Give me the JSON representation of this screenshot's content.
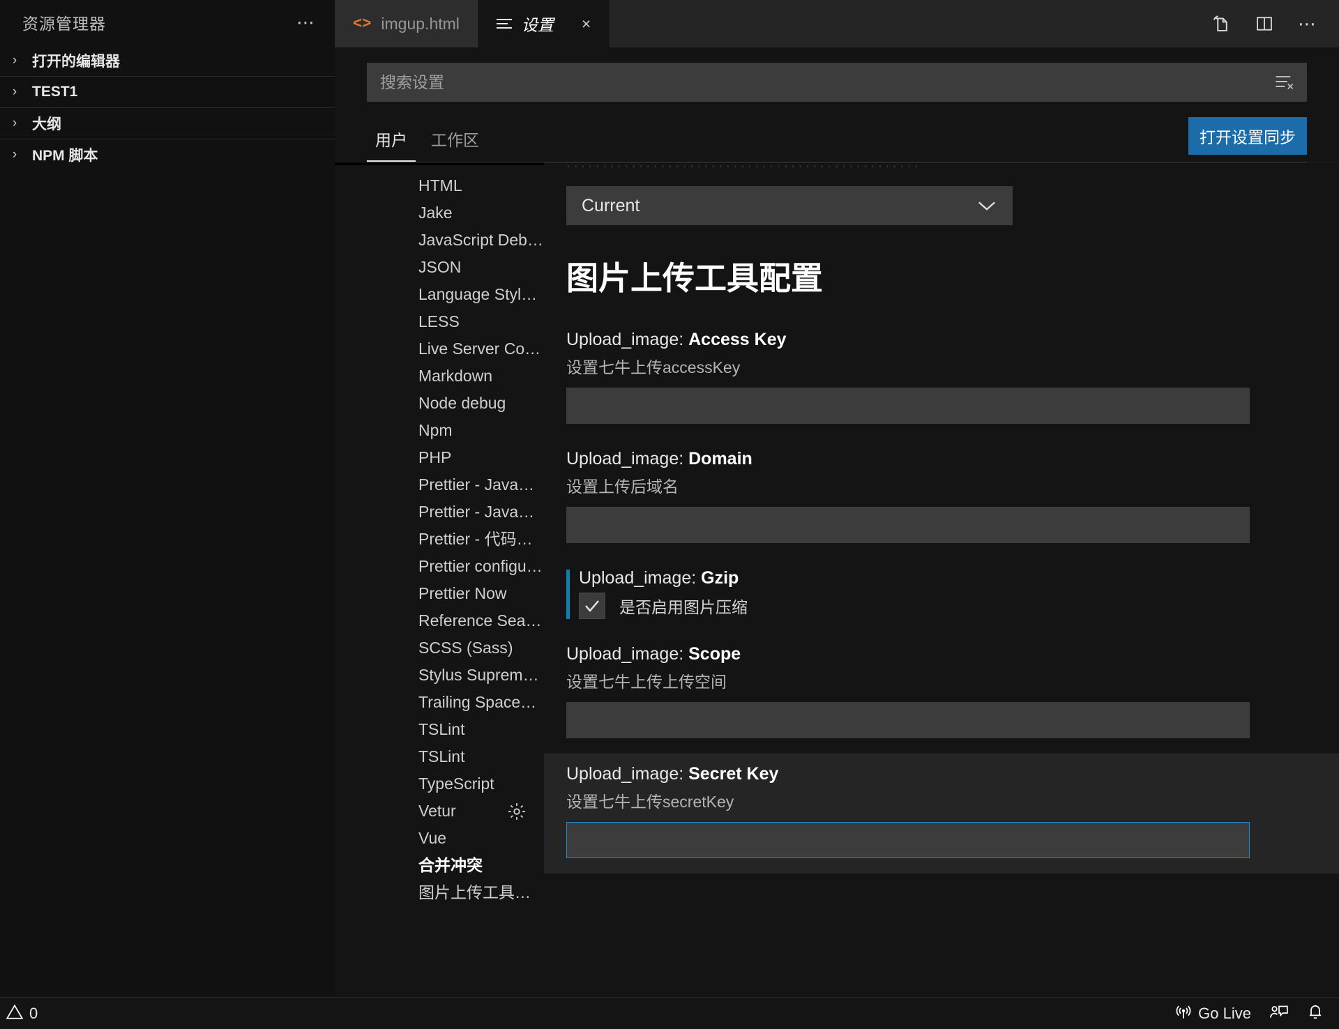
{
  "sidebar": {
    "title": "资源管理器",
    "more_icon": "ellipsis-icon",
    "items": [
      {
        "label": "打开的编辑器"
      },
      {
        "label": "TEST1"
      },
      {
        "label": "大纲"
      },
      {
        "label": "NPM 脚本"
      }
    ]
  },
  "tabs": [
    {
      "label": "imgup.html",
      "icon": "html-file-icon",
      "active": false
    },
    {
      "label": "设置",
      "icon": "settings-lines-icon",
      "active": true,
      "close": "×"
    }
  ],
  "tabbar_actions": [
    {
      "name": "open-settings-json-icon"
    },
    {
      "name": "split-editor-icon"
    },
    {
      "name": "more-actions-icon"
    }
  ],
  "search": {
    "placeholder": "搜索设置",
    "value": "",
    "clear_filters_icon": "clear-filters-icon"
  },
  "settings_tabs": [
    {
      "label": "用户",
      "active": true
    },
    {
      "label": "工作区",
      "active": false
    }
  ],
  "sync_button": {
    "label": "打开设置同步"
  },
  "toc": {
    "items": [
      {
        "label": "HTML",
        "bold": false
      },
      {
        "label": "Jake",
        "bold": false
      },
      {
        "label": "JavaScript Debug...",
        "bold": false
      },
      {
        "label": "JSON",
        "bold": false
      },
      {
        "label": "Language Stylus ...",
        "bold": false
      },
      {
        "label": "LESS",
        "bold": false
      },
      {
        "label": "Live Server Config",
        "bold": false
      },
      {
        "label": "Markdown",
        "bold": false
      },
      {
        "label": "Node debug",
        "bold": false
      },
      {
        "label": "Npm",
        "bold": false
      },
      {
        "label": "PHP",
        "bold": false
      },
      {
        "label": "Prettier - JavaScri...",
        "bold": false
      },
      {
        "label": "Prettier - JavaScri...",
        "bold": false
      },
      {
        "label": "Prettier - 代码格式...",
        "bold": false
      },
      {
        "label": "Prettier configurat...",
        "bold": false
      },
      {
        "label": "Prettier Now",
        "bold": false
      },
      {
        "label": "Reference Search ...",
        "bold": false
      },
      {
        "label": "SCSS (Sass)",
        "bold": false
      },
      {
        "label": "Stylus Supremacy",
        "bold": false
      },
      {
        "label": "Trailing Spaces C...",
        "bold": false
      },
      {
        "label": "TSLint",
        "bold": false
      },
      {
        "label": "TSLint",
        "bold": false
      },
      {
        "label": "TypeScript",
        "bold": false
      },
      {
        "label": "Vetur",
        "bold": false,
        "gear": true
      },
      {
        "label": "Vue",
        "bold": false
      },
      {
        "label": "合并冲突",
        "bold": true
      },
      {
        "label": "图片上传工具配置",
        "bold": false
      }
    ]
  },
  "settings_body": {
    "dropdown": {
      "value": "Current",
      "chevron": "chevron-down-icon"
    },
    "page_title": "图片上传工具配置",
    "rows": [
      {
        "prefix": "Upload_image: ",
        "key": "Access Key",
        "desc": "设置七牛上传accessKey",
        "control": "text",
        "value": "",
        "modified": false,
        "focused": false,
        "hovered": false
      },
      {
        "prefix": "Upload_image: ",
        "key": "Domain",
        "desc": "设置上传后域名",
        "control": "text",
        "value": "",
        "modified": false,
        "focused": false,
        "hovered": false
      },
      {
        "prefix": "Upload_image: ",
        "key": "Gzip",
        "desc": "",
        "control": "checkbox",
        "checkbox_label": "是否启用图片压缩",
        "checked": true,
        "modified": true,
        "focused": false,
        "hovered": false
      },
      {
        "prefix": "Upload_image: ",
        "key": "Scope",
        "desc": "设置七牛上传上传空间",
        "control": "text",
        "value": "",
        "modified": false,
        "focused": false,
        "hovered": false
      },
      {
        "prefix": "Upload_image: ",
        "key": "Secret Key",
        "desc": "设置七牛上传secretKey",
        "control": "text",
        "value": "",
        "modified": false,
        "focused": true,
        "hovered": true
      }
    ]
  },
  "statusbar": {
    "left": [
      {
        "name": "problems",
        "icon": "warning-triangle-icon",
        "label": "0"
      }
    ],
    "right": [
      {
        "name": "go-live",
        "icon": "broadcast-icon",
        "label": "Go Live"
      },
      {
        "name": "feedback",
        "icon": "feedback-icon",
        "label": ""
      },
      {
        "name": "notifications",
        "icon": "bell-icon",
        "label": ""
      }
    ]
  },
  "colors": {
    "accent_blue": "#1b6ca8",
    "focus_blue": "#1f8ad2",
    "modified_bar": "#0f7fae",
    "html_icon_orange": "#e37933",
    "editor_bg": "#141414",
    "input_bg": "#3c3c3c"
  }
}
